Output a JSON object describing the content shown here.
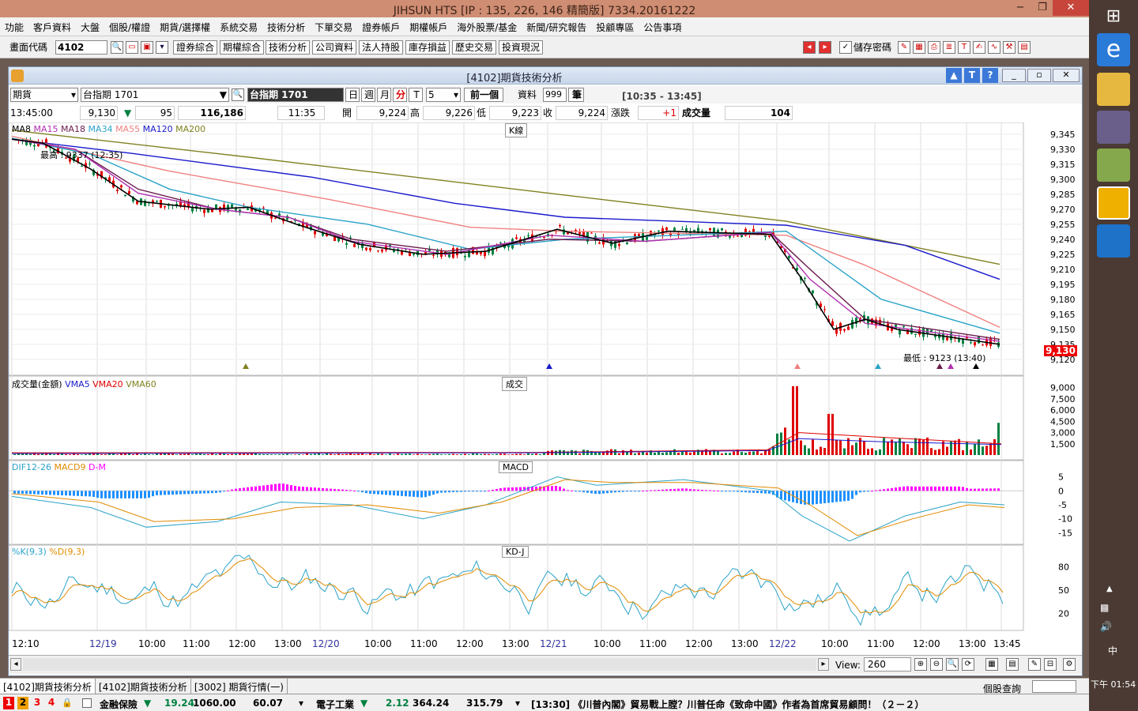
{
  "window": {
    "title": "JIHSUN HTS     [IP : 135, 226, 146 精簡版] 7334.20161222"
  },
  "menu": [
    "功能",
    "客戶資料",
    "大盤",
    "個股/權證",
    "期貨/選擇權",
    "系統交易",
    "技術分析",
    "下單交易",
    "證券帳戶",
    "期權帳戶",
    "海外股票/基金",
    "新聞/研究報告",
    "投顧專區",
    "公告事項"
  ],
  "toolbar": {
    "code_label": "畫面代碼",
    "code_value": "4102",
    "buttons": [
      "證券綜合",
      "期權綜合",
      "技術分析",
      "公司資料",
      "法人持股",
      "庫存損益",
      "歷史交易",
      "投資現況"
    ],
    "save_pwd_label": "儲存密碼"
  },
  "child": {
    "title": "[4102]期貨技術分析"
  },
  "controls": {
    "product": "期貨",
    "contract": "台指期 1701",
    "selected_name": "台指期 1701",
    "periods": [
      "日",
      "週",
      "月",
      "分",
      "T"
    ],
    "interval": "5",
    "prev_btn": "前一個",
    "data_label": "資料",
    "data_count": "999",
    "count_unit": "筆",
    "time_range": "[10:35 - 13:45]"
  },
  "quote": {
    "time": "13:45:00",
    "price": "9,130",
    "change": "95",
    "volume_total": "116,186",
    "bar_time": "11:35",
    "open_label": "開",
    "open": "9,224",
    "high_label": "高",
    "high": "9,226",
    "low_label": "低",
    "low": "9,223",
    "close_label": "收",
    "close": "9,224",
    "chg_label": "漲跌",
    "chg": "+1",
    "vol_label": "成交量",
    "vol": "104"
  },
  "panels": {
    "kline": {
      "title": "K線",
      "legend": [
        "MA8",
        "MA15",
        "MA18",
        "MA34",
        "MA55",
        "MA120",
        "MA200"
      ],
      "high_note": "最高 : 9337 (12:35)",
      "low_note": "最低 : 9123 (13:40)",
      "last_price": "9,130"
    },
    "volume": {
      "title": "成交",
      "legend": [
        "成交量(金額)",
        "VMA5",
        "VMA20",
        "VMA60"
      ]
    },
    "macd": {
      "title": "MACD",
      "legend": [
        "DIF12-26",
        "MACD9",
        "D-M"
      ]
    },
    "kd": {
      "title": "KD-J",
      "legend": [
        "%K(9,3)",
        "%D(9,3)"
      ]
    }
  },
  "colors": {
    "MA8": "#000000",
    "MA15": "#b030b0",
    "MA18": "#6a1b4d",
    "MA34": "#2aa3c8",
    "MA55": "#f08080",
    "MA120": "#1a1acc",
    "MA200": "#808020",
    "up": "#e00000",
    "down": "#008040",
    "macd_pos": "#ff00ff",
    "macd_neg": "#1e90ff"
  },
  "chart_data": [
    {
      "type": "line",
      "title": "K線",
      "ylim": [
        9112,
        9352
      ],
      "y_ticks": [
        "9,345",
        "9,330",
        "9,315",
        "9,300",
        "9,285",
        "9,270",
        "9,255",
        "9,240",
        "9,225",
        "9,210",
        "9,195",
        "9,180",
        "9,165",
        "9,150",
        "9,135",
        "9,120"
      ],
      "series": [
        {
          "name": "MA200",
          "points": [
            [
              0,
              9349
            ],
            [
              300,
              9322
            ],
            [
              690,
              9285
            ],
            [
              980,
              9258
            ],
            [
              1250,
              9215
            ]
          ]
        },
        {
          "name": "MA120",
          "points": [
            [
              0,
              9340
            ],
            [
              150,
              9326
            ],
            [
              380,
              9302
            ],
            [
              560,
              9276
            ],
            [
              700,
              9262
            ],
            [
              980,
              9254
            ],
            [
              1130,
              9234
            ],
            [
              1250,
              9200
            ]
          ]
        },
        {
          "name": "MA55",
          "points": [
            [
              0,
              9343
            ],
            [
              200,
              9308
            ],
            [
              400,
              9280
            ],
            [
              580,
              9252
            ],
            [
              700,
              9248
            ],
            [
              980,
              9244
            ],
            [
              1080,
              9214
            ],
            [
              1250,
              9152
            ]
          ]
        },
        {
          "name": "MA34",
          "points": [
            [
              0,
              9341
            ],
            [
              100,
              9325
            ],
            [
              200,
              9290
            ],
            [
              300,
              9272
            ],
            [
              450,
              9255
            ],
            [
              580,
              9230
            ],
            [
              700,
              9240
            ],
            [
              980,
              9248
            ],
            [
              1100,
              9180
            ],
            [
              1250,
              9146
            ]
          ]
        },
        {
          "name": "MA18",
          "points": [
            [
              0,
              9340
            ],
            [
              80,
              9330
            ],
            [
              160,
              9290
            ],
            [
              260,
              9270
            ],
            [
              350,
              9262
            ],
            [
              430,
              9240
            ],
            [
              550,
              9228
            ],
            [
              680,
              9240
            ],
            [
              800,
              9238
            ],
            [
              960,
              9247
            ],
            [
              1010,
              9210
            ],
            [
              1080,
              9160
            ],
            [
              1250,
              9140
            ]
          ]
        },
        {
          "name": "MA15",
          "points": [
            [
              0,
              9340
            ],
            [
              80,
              9330
            ],
            [
              160,
              9286
            ],
            [
              260,
              9270
            ],
            [
              350,
              9262
            ],
            [
              430,
              9238
            ],
            [
              550,
              9225
            ],
            [
              680,
              9244
            ],
            [
              800,
              9238
            ],
            [
              960,
              9247
            ],
            [
              1010,
              9200
            ],
            [
              1080,
              9156
            ],
            [
              1250,
              9138
            ]
          ]
        },
        {
          "name": "MA8",
          "points": [
            [
              0,
              9340
            ],
            [
              40,
              9336
            ],
            [
              100,
              9310
            ],
            [
              160,
              9278
            ],
            [
              250,
              9270
            ],
            [
              300,
              9272
            ],
            [
              360,
              9255
            ],
            [
              440,
              9235
            ],
            [
              520,
              9225
            ],
            [
              600,
              9228
            ],
            [
              690,
              9250
            ],
            [
              760,
              9236
            ],
            [
              830,
              9248
            ],
            [
              960,
              9245
            ],
            [
              1000,
              9200
            ],
            [
              1040,
              9150
            ],
            [
              1080,
              9160
            ],
            [
              1120,
              9150
            ],
            [
              1250,
              9135
            ]
          ]
        }
      ]
    },
    {
      "type": "bar",
      "title": "成交",
      "ylim": [
        0,
        9500
      ],
      "y_ticks": [
        "9,000",
        "7,500",
        "6,000",
        "4,500",
        "3,000",
        "1,500"
      ]
    },
    {
      "type": "bar",
      "title": "MACD",
      "ylim": [
        -18,
        8
      ],
      "y_ticks": [
        "5",
        "0",
        "-5",
        "-10",
        "-15"
      ]
    },
    {
      "type": "line",
      "title": "KD-J",
      "ylim": [
        0,
        100
      ],
      "y_ticks": [
        "80",
        "50",
        "20"
      ]
    }
  ],
  "xaxis": {
    "labels": [
      "12:10",
      "12/19",
      "10:00",
      "11:00",
      "12:00",
      "13:00",
      "12/20",
      "10:00",
      "11:00",
      "12:00",
      "13:00",
      "12/21",
      "10:00",
      "11:00",
      "12:00",
      "13:00",
      "12/22",
      "10:00",
      "11:00",
      "12:00",
      "13:00",
      "13:45"
    ]
  },
  "scroll": {
    "view_label": "View:",
    "view_value": "260"
  },
  "tabs": [
    "[4102]期貨技術分析",
    "[4102]期貨技術分析",
    "[3002] 期貨行情(一)"
  ],
  "tabs_right": "個股查詢",
  "status": {
    "pages": [
      "1",
      "2",
      "3",
      "4"
    ],
    "idx1_name": "金融保險",
    "idx1_chg": "19.24",
    "idx1_val": "1060.00",
    "idx1_vol": "60.07",
    "idx2_name": "電子工業",
    "idx2_chg": "2.12",
    "idx2_val": "364.24",
    "idx2_vol": "315.79",
    "news": "[13:30]  《川普內閣》貿易戰上膛？川普任命《致命中國》作者為首席貿易顧問！（２－２）"
  },
  "taskbar": {
    "clock": "下午 01:54",
    "ime": "中"
  }
}
